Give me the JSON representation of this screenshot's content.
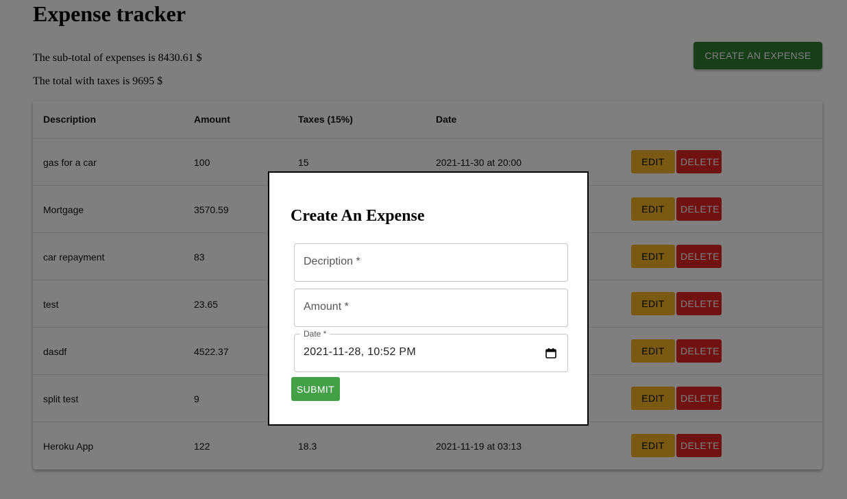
{
  "title": "Expense tracker",
  "summary": {
    "subtotal_text": "The sub-total of expenses is 8430.61 $",
    "total_text": "The total with taxes is 9695 $"
  },
  "create_button_label": "CREATE AN EXPENSE",
  "table": {
    "headers": [
      "Description",
      "Amount",
      "Taxes (15%)",
      "Date"
    ],
    "rows": [
      {
        "description": "gas for a car",
        "amount": "100",
        "taxes": "15",
        "date": "2021-11-30 at 20:00"
      },
      {
        "description": "Mortgage",
        "amount": "3570.59",
        "taxes": "",
        "date": ""
      },
      {
        "description": "car repayment",
        "amount": "83",
        "taxes": "",
        "date": ""
      },
      {
        "description": "test",
        "amount": "23.65",
        "taxes": "",
        "date": ""
      },
      {
        "description": "dasdf",
        "amount": "4522.37",
        "taxes": "",
        "date": ""
      },
      {
        "description": "split test",
        "amount": "9",
        "taxes": "",
        "date": ""
      },
      {
        "description": "Heroku App",
        "amount": "122",
        "taxes": "18.3",
        "date": "2021-11-19 at 03:13"
      }
    ],
    "edit_label": "EDIT",
    "delete_label": "DELETE"
  },
  "modal": {
    "title": "Create An Expense",
    "description_placeholder": "Decription *",
    "amount_placeholder": "Amount *",
    "date_label": "Date *",
    "date_value": "2021-11-28, 10:52 PM",
    "submit_label": "SUBMIT"
  },
  "colors": {
    "create_button": "#2e7d32",
    "edit_button": "#f5b324",
    "delete_button": "#e22424",
    "submit_button": "#43a047"
  }
}
